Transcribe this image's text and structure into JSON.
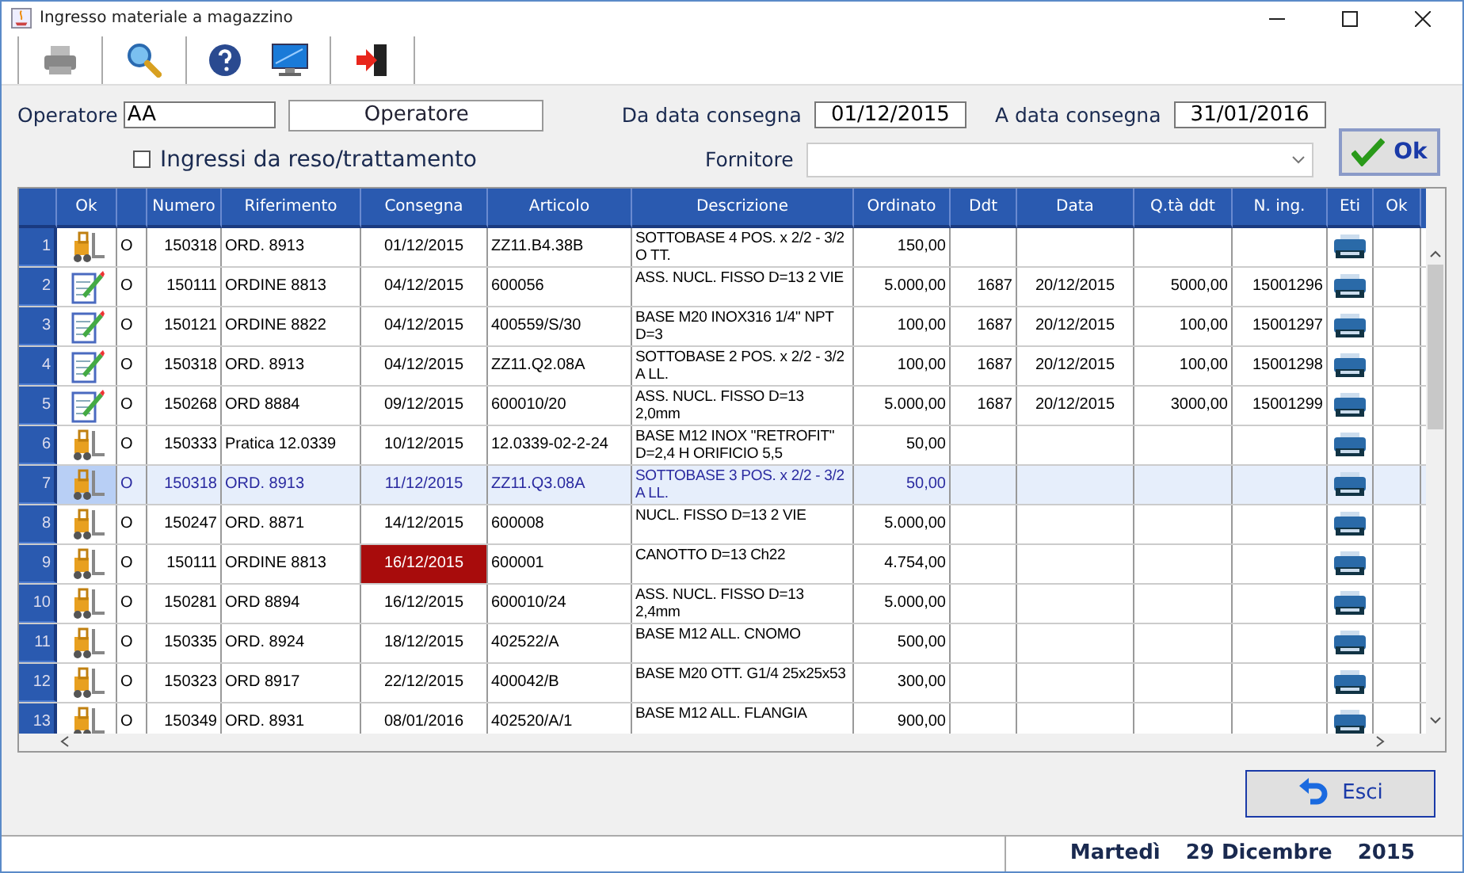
{
  "window": {
    "title": "Ingresso materiale a magazzino"
  },
  "form": {
    "operator_label": "Operatore",
    "operator_value": "AA",
    "operator_button": "Operatore",
    "from_label": "Da data consegna",
    "from_value": "01/12/2015",
    "to_label": "A data consegna",
    "to_value": "31/01/2016",
    "returns_label": "Ingressi da reso/trattamento",
    "returns_checked": false,
    "supplier_label": "Fornitore",
    "ok_button": "Ok"
  },
  "table": {
    "columns": [
      {},
      {
        "label": "Ok"
      },
      {},
      {
        "label": "Numero"
      },
      {
        "label": "Riferimento"
      },
      {
        "label": "Consegna"
      },
      {
        "label": "Articolo"
      },
      {
        "label": "Descrizione"
      },
      {
        "label": "Ordinato"
      },
      {
        "label": "Ddt"
      },
      {
        "label": "Data"
      },
      {
        "label": "Q.tà ddt"
      },
      {
        "label": "N. ing."
      },
      {
        "label": "Eti"
      },
      {
        "label": "Ok"
      }
    ],
    "rows": [
      {
        "index": "1",
        "kind": "forklift",
        "flag": "O",
        "numero": "150318",
        "riferimento": "ORD. 8913",
        "consegna": "01/12/2015",
        "articolo": "ZZ11.B4.38B",
        "descrizione": "SOTTOBASE 4 POS. x 2/2 - 3/2 O TT.",
        "ordinato": "150,00",
        "selected": false,
        "overdue": false
      },
      {
        "index": "2",
        "kind": "edit",
        "flag": "O",
        "numero": "150111",
        "riferimento": "ORDINE 8813",
        "consegna": "04/12/2015",
        "articolo": "600056",
        "descrizione": "ASS. NUCL. FISSO D=13 2 VIE",
        "ordinato": "5.000,00",
        "ddt": "1687",
        "data": "20/12/2015",
        "qta": "5000,00",
        "ning": "15001296",
        "selected": false,
        "overdue": false
      },
      {
        "index": "3",
        "kind": "edit",
        "flag": "O",
        "numero": "150121",
        "riferimento": "ORDINE 8822",
        "consegna": "04/12/2015",
        "articolo": "400559/S/30",
        "descrizione": "BASE M20 INOX316 1/4\" NPT D=3",
        "ordinato": "100,00",
        "ddt": "1687",
        "data": "20/12/2015",
        "qta": "100,00",
        "ning": "15001297",
        "selected": false,
        "overdue": false
      },
      {
        "index": "4",
        "kind": "edit",
        "flag": "O",
        "numero": "150318",
        "riferimento": "ORD. 8913",
        "consegna": "04/12/2015",
        "articolo": "ZZ11.Q2.08A",
        "descrizione": "SOTTOBASE 2 POS. x 2/2 - 3/2 A LL.",
        "ordinato": "100,00",
        "ddt": "1687",
        "data": "20/12/2015",
        "qta": "100,00",
        "ning": "15001298",
        "selected": false,
        "overdue": false
      },
      {
        "index": "5",
        "kind": "edit",
        "flag": "O",
        "numero": "150268",
        "riferimento": "ORD 8884",
        "consegna": "09/12/2015",
        "articolo": "600010/20",
        "descrizione": "ASS. NUCL. FISSO D=13 2,0mm",
        "ordinato": "5.000,00",
        "ddt": "1687",
        "data": "20/12/2015",
        "qta": "3000,00",
        "ning": "15001299",
        "selected": false,
        "overdue": false
      },
      {
        "index": "6",
        "kind": "forklift",
        "flag": "O",
        "numero": "150333",
        "riferimento": "Pratica 12.0339",
        "consegna": "10/12/2015",
        "articolo": "12.0339-02-2-24",
        "descrizione": "BASE M12 INOX \"RETROFIT\" D=2,4 H ORIFICIO 5,5",
        "ordinato": "50,00",
        "selected": false,
        "overdue": false
      },
      {
        "index": "7",
        "kind": "forklift",
        "flag": "O",
        "numero": "150318",
        "riferimento": "ORD. 8913",
        "consegna": "11/12/2015",
        "articolo": "ZZ11.Q3.08A",
        "descrizione": "SOTTOBASE 3 POS. x 2/2 - 3/2 A LL.",
        "ordinato": "50,00",
        "selected": true,
        "overdue": false
      },
      {
        "index": "8",
        "kind": "forklift",
        "flag": "O",
        "numero": "150247",
        "riferimento": "ORD. 8871",
        "consegna": "14/12/2015",
        "articolo": "600008",
        "descrizione": "NUCL. FISSO D=13 2 VIE",
        "ordinato": "5.000,00",
        "selected": false,
        "overdue": false
      },
      {
        "index": "9",
        "kind": "forklift",
        "flag": "O",
        "numero": "150111",
        "riferimento": "ORDINE 8813",
        "consegna": "16/12/2015",
        "articolo": "600001",
        "descrizione": "CANOTTO D=13 Ch22",
        "ordinato": "4.754,00",
        "selected": false,
        "overdue": true
      },
      {
        "index": "10",
        "kind": "forklift",
        "flag": "O",
        "numero": "150281",
        "riferimento": "ORD 8894",
        "consegna": "16/12/2015",
        "articolo": "600010/24",
        "descrizione": "ASS. NUCL. FISSO D=13 2,4mm",
        "ordinato": "5.000,00",
        "selected": false,
        "overdue": false
      },
      {
        "index": "11",
        "kind": "forklift",
        "flag": "O",
        "numero": "150335",
        "riferimento": "ORD. 8924",
        "consegna": "18/12/2015",
        "articolo": "402522/A",
        "descrizione": "BASE M12 ALL. CNOMO",
        "ordinato": "500,00",
        "selected": false,
        "overdue": false
      },
      {
        "index": "12",
        "kind": "forklift",
        "flag": "O",
        "numero": "150323",
        "riferimento": "ORD 8917",
        "consegna": "22/12/2015",
        "articolo": "400042/B",
        "descrizione": "BASE M20 OTT. G1/4 25x25x53",
        "ordinato": "300,00",
        "selected": false,
        "overdue": false
      },
      {
        "index": "13",
        "kind": "forklift",
        "flag": "O",
        "numero": "150349",
        "riferimento": "ORD. 8931",
        "consegna": "08/01/2016",
        "articolo": "402520/A/1",
        "descrizione": "BASE M12 ALL. FLANGIA",
        "ordinato": "900,00",
        "selected": false,
        "overdue": false
      }
    ]
  },
  "exit_button": "Esci",
  "status_bar": {
    "weekday": "Martedì",
    "date": "29 Dicembre",
    "year": "2015"
  }
}
